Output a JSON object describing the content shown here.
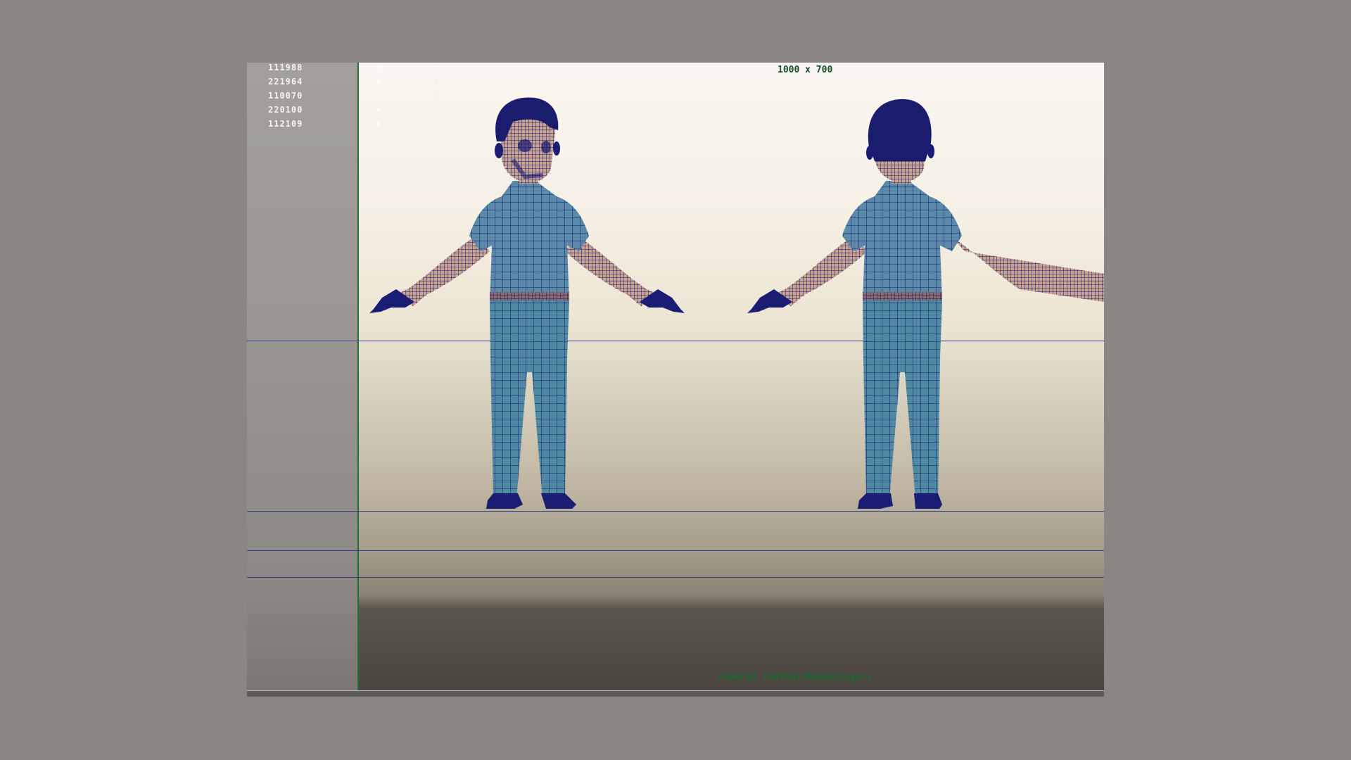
{
  "viewport": {
    "resolution_label": "1000 x 700",
    "camera_label": "camera2 (defaultRenderLayer)"
  },
  "hud": {
    "stats": [
      {
        "value": "111988",
        "secondary": "0"
      },
      {
        "value": "221964",
        "secondary": "0"
      },
      {
        "value": "110070",
        "secondary": "0"
      },
      {
        "value": "220100",
        "secondary": "0"
      },
      {
        "value": "112109",
        "secondary": "0"
      }
    ]
  },
  "colors": {
    "wireframe": "#13157a",
    "shirt": "#5a8aa8",
    "pants": "#4f8aa0",
    "skin": "#c9a48e",
    "hair": "#1a1c6e",
    "belt": "#8a6b6c",
    "shoes": "#1b1c74",
    "guide_line": "#2b3a8a",
    "resolution_text": "#15502a"
  },
  "icons": [
    "front-view-character",
    "back-view-character"
  ]
}
